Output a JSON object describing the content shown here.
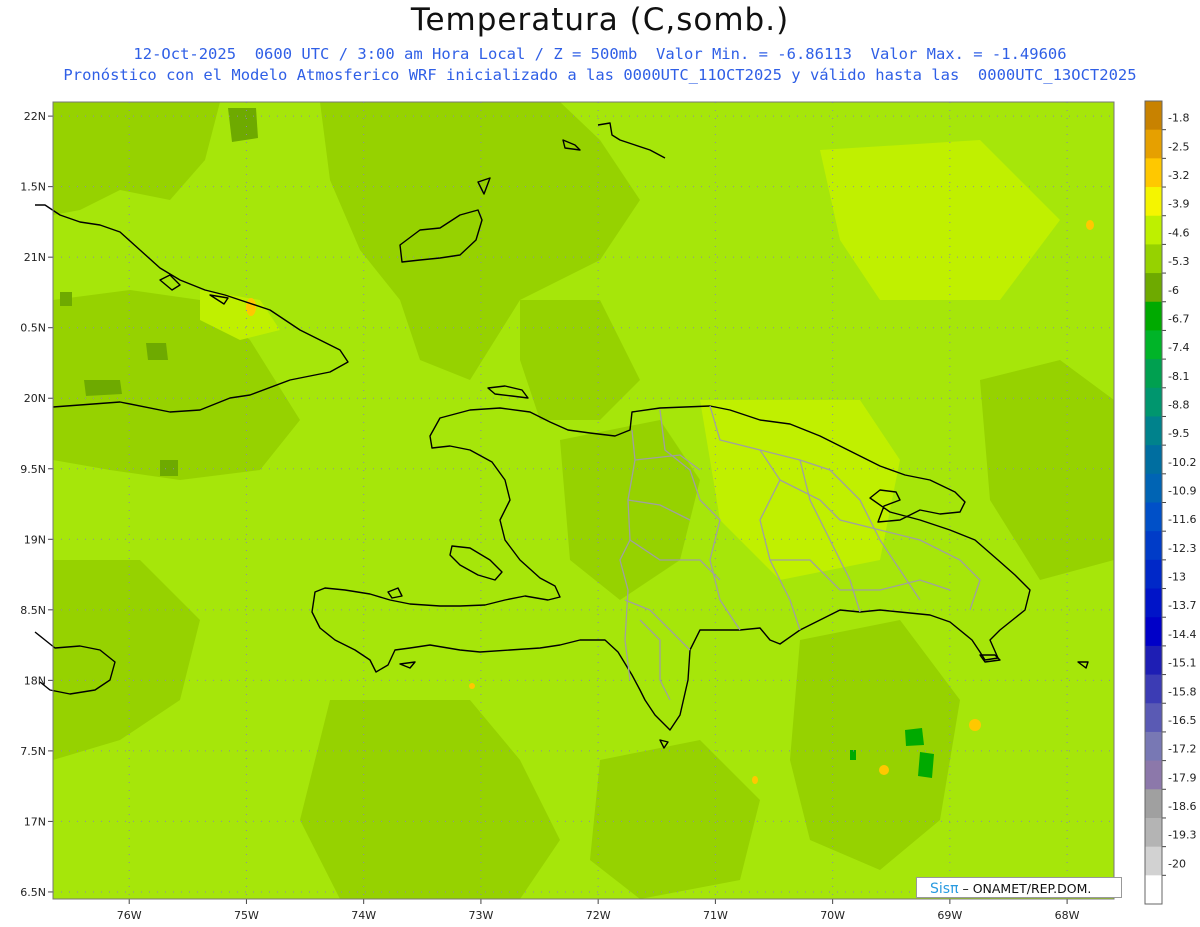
{
  "title": "Temperatura (C,somb.)",
  "subtitle_line1": "12-Oct-2025  0600 UTC / 3:00 am Hora Local / Z = 500mb  Valor Min. = -6.86113  Valor Max. = -1.49606",
  "subtitle_line2": "Pronóstico con el Modelo Atmosferico WRF inicializado a las 0000UTC_11OCT2025 y válido hasta las  0000UTC_13OCT2025",
  "credit": {
    "brand": "Sisπ",
    "text": " – ONAMET/REP.DOM."
  },
  "map": {
    "lon_range": [
      -76.65,
      -67.6
    ],
    "lat_range": [
      16.45,
      22.1
    ],
    "lat_ticks": [
      {
        "value": 22.0,
        "label": "22N"
      },
      {
        "value": 21.5,
        "label": "1.5N"
      },
      {
        "value": 21.0,
        "label": "21N"
      },
      {
        "value": 20.5,
        "label": "0.5N"
      },
      {
        "value": 20.0,
        "label": "20N"
      },
      {
        "value": 19.5,
        "label": "9.5N"
      },
      {
        "value": 19.0,
        "label": "19N"
      },
      {
        "value": 18.5,
        "label": "8.5N"
      },
      {
        "value": 18.0,
        "label": "18N"
      },
      {
        "value": 17.5,
        "label": "7.5N"
      },
      {
        "value": 17.0,
        "label": "17N"
      },
      {
        "value": 16.5,
        "label": "6.5N"
      }
    ],
    "lon_ticks": [
      {
        "value": -76,
        "label": "76W"
      },
      {
        "value": -75,
        "label": "75W"
      },
      {
        "value": -74,
        "label": "74W"
      },
      {
        "value": -73,
        "label": "73W"
      },
      {
        "value": -72,
        "label": "72W"
      },
      {
        "value": -71,
        "label": "71W"
      },
      {
        "value": -70,
        "label": "70W"
      },
      {
        "value": -69,
        "label": "69W"
      },
      {
        "value": -68,
        "label": "68W"
      }
    ],
    "background_color": "#a6e60a",
    "coast_color": "#000000",
    "province_color": "#a0a0a0"
  },
  "colorbar": {
    "levels": [
      {
        "label": "-1.8",
        "color": "#c88200"
      },
      {
        "label": "-2.5",
        "color": "#e6a000"
      },
      {
        "label": "-3.2",
        "color": "#ffc800"
      },
      {
        "label": "-3.9",
        "color": "#f5f500"
      },
      {
        "label": "-4.6",
        "color": "#bef000"
      },
      {
        "label": "-5.3",
        "color": "#96d200"
      },
      {
        "label": "-6",
        "color": "#6eaa00"
      },
      {
        "label": "-6.7",
        "color": "#00aa00"
      },
      {
        "label": "-7.4",
        "color": "#00b428"
      },
      {
        "label": "-8.1",
        "color": "#00a050"
      },
      {
        "label": "-8.8",
        "color": "#00966e"
      },
      {
        "label": "-9.5",
        "color": "#00828c"
      },
      {
        "label": "-10.2",
        "color": "#006ea0"
      },
      {
        "label": "-10.9",
        "color": "#0064b4"
      },
      {
        "label": "-11.6",
        "color": "#0050c8"
      },
      {
        "label": "-12.3",
        "color": "#003cc8"
      },
      {
        "label": "-13",
        "color": "#0028c8"
      },
      {
        "label": "-13.7",
        "color": "#0014c8"
      },
      {
        "label": "-14.4",
        "color": "#0000c8"
      },
      {
        "label": "-15.1",
        "color": "#1e1eb4"
      },
      {
        "label": "-15.8",
        "color": "#3c3cb4"
      },
      {
        "label": "-16.5",
        "color": "#5a5ab4"
      },
      {
        "label": "-17.2",
        "color": "#7878b4"
      },
      {
        "label": "-17.9",
        "color": "#8c78aa"
      },
      {
        "label": "-18.6",
        "color": "#a0a0a0"
      },
      {
        "label": "-19.3",
        "color": "#b4b4b4"
      },
      {
        "label": "-20",
        "color": "#d2d2d2"
      },
      {
        "label": "",
        "color": "#ffffff"
      }
    ]
  }
}
